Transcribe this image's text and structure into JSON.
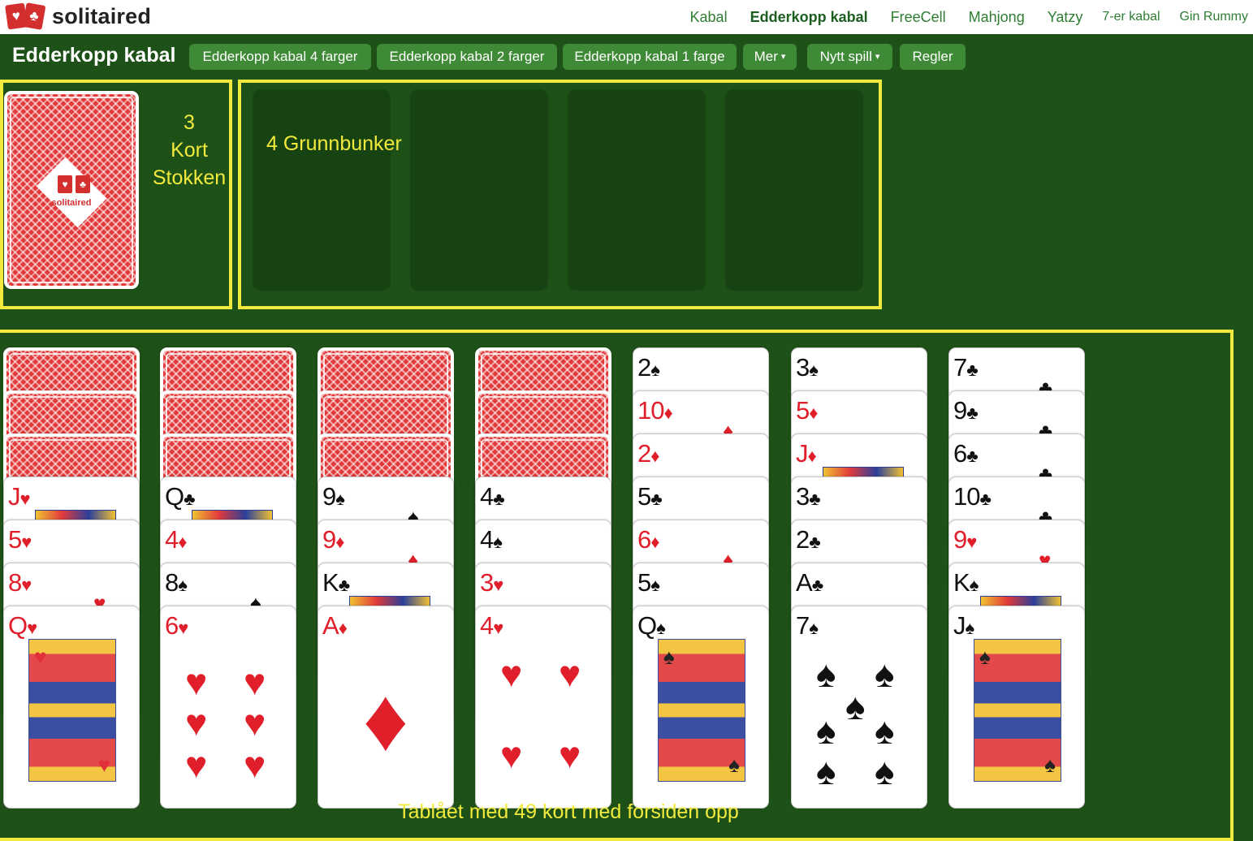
{
  "brand": {
    "name": "solitaired",
    "logo_suits": [
      "♥",
      "♣"
    ]
  },
  "nav": [
    {
      "label": "Kabal",
      "active": false
    },
    {
      "label": "Edderkopp kabal",
      "active": true
    },
    {
      "label": "FreeCell",
      "active": false
    },
    {
      "label": "Mahjong",
      "active": false
    },
    {
      "label": "Yatzy",
      "active": false
    },
    {
      "label": "7-er kabal",
      "active": false
    },
    {
      "label": "Gin Rummy",
      "active": false
    }
  ],
  "toolbar": {
    "title": "Edderkopp kabal",
    "buttons": [
      {
        "label": "Edderkopp kabal 4 farger"
      },
      {
        "label": "Edderkopp kabal 2 farger"
      },
      {
        "label": "Edderkopp kabal 1 farge"
      },
      {
        "label": "Mer",
        "dropdown": true
      },
      {
        "label": "Nytt spill",
        "dropdown": true
      },
      {
        "label": "Regler"
      }
    ],
    "caret": "▾"
  },
  "annotations": {
    "stock_count": "3",
    "stock_word1": "Kort",
    "stock_word2": "Stokken",
    "foundations": "4 Grunnbunker",
    "tableau": "Tablået med 49 kort med forsiden opp"
  },
  "deck_card": {
    "brand": "solitaired"
  },
  "colors": {
    "felt": "#1e5118",
    "annotation": "#f1ea3c",
    "button": "#3f8a36",
    "card_back": "#e23a3a"
  },
  "tableau": [
    {
      "backs": 3,
      "cards": [
        {
          "rank": "J",
          "suit": "♥",
          "color": "red"
        },
        {
          "rank": "5",
          "suit": "♥",
          "color": "red"
        },
        {
          "rank": "8",
          "suit": "♥",
          "color": "red"
        },
        {
          "rank": "Q",
          "suit": "♥",
          "color": "red"
        }
      ]
    },
    {
      "backs": 3,
      "cards": [
        {
          "rank": "Q",
          "suit": "♣",
          "color": "black"
        },
        {
          "rank": "4",
          "suit": "♦",
          "color": "red"
        },
        {
          "rank": "8",
          "suit": "♠",
          "color": "black"
        },
        {
          "rank": "6",
          "suit": "♥",
          "color": "red"
        }
      ]
    },
    {
      "backs": 3,
      "cards": [
        {
          "rank": "9",
          "suit": "♠",
          "color": "black"
        },
        {
          "rank": "9",
          "suit": "♦",
          "color": "red"
        },
        {
          "rank": "K",
          "suit": "♣",
          "color": "black"
        },
        {
          "rank": "A",
          "suit": "♦",
          "color": "red"
        }
      ]
    },
    {
      "backs": 3,
      "cards": [
        {
          "rank": "4",
          "suit": "♣",
          "color": "black"
        },
        {
          "rank": "4",
          "suit": "♠",
          "color": "black"
        },
        {
          "rank": "3",
          "suit": "♥",
          "color": "red"
        },
        {
          "rank": "4",
          "suit": "♥",
          "color": "red"
        }
      ]
    },
    {
      "backs": 0,
      "cards": [
        {
          "rank": "2",
          "suit": "♠",
          "color": "black"
        },
        {
          "rank": "10",
          "suit": "♦",
          "color": "red"
        },
        {
          "rank": "2",
          "suit": "♦",
          "color": "red"
        },
        {
          "rank": "5",
          "suit": "♣",
          "color": "black"
        },
        {
          "rank": "6",
          "suit": "♦",
          "color": "red"
        },
        {
          "rank": "5",
          "suit": "♠",
          "color": "black"
        },
        {
          "rank": "Q",
          "suit": "♠",
          "color": "black"
        }
      ]
    },
    {
      "backs": 0,
      "cards": [
        {
          "rank": "3",
          "suit": "♠",
          "color": "black"
        },
        {
          "rank": "5",
          "suit": "♦",
          "color": "red"
        },
        {
          "rank": "J",
          "suit": "♦",
          "color": "red"
        },
        {
          "rank": "3",
          "suit": "♣",
          "color": "black"
        },
        {
          "rank": "2",
          "suit": "♣",
          "color": "black"
        },
        {
          "rank": "A",
          "suit": "♣",
          "color": "black"
        },
        {
          "rank": "7",
          "suit": "♠",
          "color": "black"
        }
      ]
    },
    {
      "backs": 0,
      "cards": [
        {
          "rank": "7",
          "suit": "♣",
          "color": "black"
        },
        {
          "rank": "9",
          "suit": "♣",
          "color": "black"
        },
        {
          "rank": "6",
          "suit": "♣",
          "color": "black"
        },
        {
          "rank": "10",
          "suit": "♣",
          "color": "black"
        },
        {
          "rank": "9",
          "suit": "♥",
          "color": "red"
        },
        {
          "rank": "K",
          "suit": "♠",
          "color": "black"
        },
        {
          "rank": "J",
          "suit": "♠",
          "color": "black"
        }
      ]
    }
  ]
}
